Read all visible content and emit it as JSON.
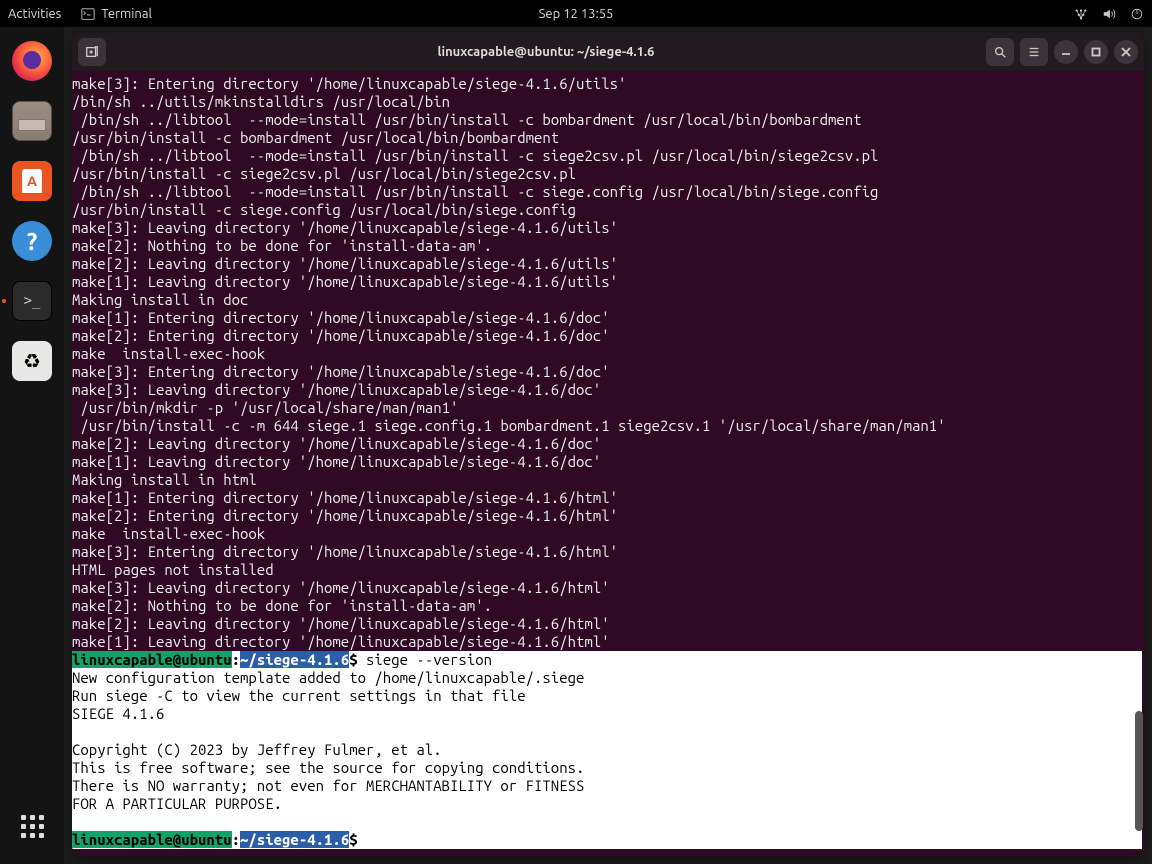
{
  "topbar": {
    "activities": "Activities",
    "app_name": "Terminal",
    "clock": "Sep 12  13:55"
  },
  "dock": {
    "items": [
      {
        "name": "firefox",
        "label": "Firefox"
      },
      {
        "name": "files",
        "label": "Files"
      },
      {
        "name": "software",
        "label": "Ubuntu Software"
      },
      {
        "name": "help",
        "label": "Help"
      },
      {
        "name": "terminal",
        "label": "Terminal",
        "active": true
      },
      {
        "name": "trash",
        "label": "Trash"
      }
    ]
  },
  "window": {
    "title": "linuxcapable@ubuntu: ~/siege-4.1.6"
  },
  "prompt": {
    "user": "linuxcapable@ubuntu",
    "colon": ":",
    "path": "~/siege-4.1.6",
    "dollar": "$",
    "command1": " siege --version",
    "command2": " "
  },
  "terminal_output": [
    "make[3]: Entering directory '/home/linuxcapable/siege-4.1.6/utils'",
    "/bin/sh ../utils/mkinstalldirs /usr/local/bin",
    " /bin/sh ../libtool  --mode=install /usr/bin/install -c bombardment /usr/local/bin/bombardment",
    "/usr/bin/install -c bombardment /usr/local/bin/bombardment",
    " /bin/sh ../libtool  --mode=install /usr/bin/install -c siege2csv.pl /usr/local/bin/siege2csv.pl",
    "/usr/bin/install -c siege2csv.pl /usr/local/bin/siege2csv.pl",
    " /bin/sh ../libtool  --mode=install /usr/bin/install -c siege.config /usr/local/bin/siege.config",
    "/usr/bin/install -c siege.config /usr/local/bin/siege.config",
    "make[3]: Leaving directory '/home/linuxcapable/siege-4.1.6/utils'",
    "make[2]: Nothing to be done for 'install-data-am'.",
    "make[2]: Leaving directory '/home/linuxcapable/siege-4.1.6/utils'",
    "make[1]: Leaving directory '/home/linuxcapable/siege-4.1.6/utils'",
    "Making install in doc",
    "make[1]: Entering directory '/home/linuxcapable/siege-4.1.6/doc'",
    "make[2]: Entering directory '/home/linuxcapable/siege-4.1.6/doc'",
    "make  install-exec-hook",
    "make[3]: Entering directory '/home/linuxcapable/siege-4.1.6/doc'",
    "make[3]: Leaving directory '/home/linuxcapable/siege-4.1.6/doc'",
    " /usr/bin/mkdir -p '/usr/local/share/man/man1'",
    " /usr/bin/install -c -m 644 siege.1 siege.config.1 bombardment.1 siege2csv.1 '/usr/local/share/man/man1'",
    "make[2]: Leaving directory '/home/linuxcapable/siege-4.1.6/doc'",
    "make[1]: Leaving directory '/home/linuxcapable/siege-4.1.6/doc'",
    "Making install in html",
    "make[1]: Entering directory '/home/linuxcapable/siege-4.1.6/html'",
    "make[2]: Entering directory '/home/linuxcapable/siege-4.1.6/html'",
    "make  install-exec-hook",
    "make[3]: Entering directory '/home/linuxcapable/siege-4.1.6/html'",
    "HTML pages not installed",
    "make[3]: Leaving directory '/home/linuxcapable/siege-4.1.6/html'",
    "make[2]: Nothing to be done for 'install-data-am'.",
    "make[2]: Leaving directory '/home/linuxcapable/siege-4.1.6/html'",
    "make[1]: Leaving directory '/home/linuxcapable/siege-4.1.6/html'"
  ],
  "selected_output": [
    "New configuration template added to /home/linuxcapable/.siege",
    "Run siege -C to view the current settings in that file",
    "SIEGE 4.1.6",
    "",
    "Copyright (C) 2023 by Jeffrey Fulmer, et al.",
    "This is free software; see the source for copying conditions.",
    "There is NO warranty; not even for MERCHANTABILITY or FITNESS",
    "FOR A PARTICULAR PURPOSE.",
    ""
  ]
}
